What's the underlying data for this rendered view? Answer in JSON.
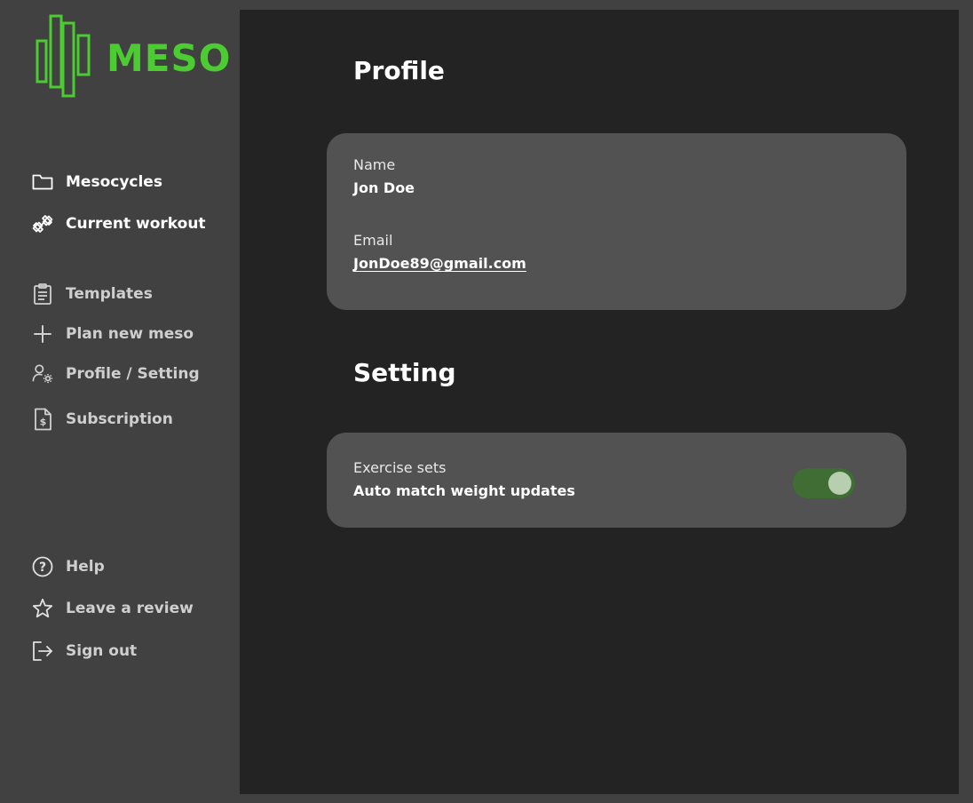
{
  "brand": {
    "name": "MESO",
    "color": "#4ccb32"
  },
  "sidebar": {
    "primary": [
      {
        "label": "Mesocycles",
        "icon": "folder-icon"
      },
      {
        "label": "Current workout",
        "icon": "dumbbell-icon"
      }
    ],
    "secondary": [
      {
        "label": "Templates",
        "icon": "clipboard-icon"
      },
      {
        "label": "Plan new meso",
        "icon": "plus-icon"
      },
      {
        "label": "Profile / Setting",
        "icon": "user-gear-icon"
      },
      {
        "label": "Subscription",
        "icon": "dollar-document-icon"
      }
    ],
    "bottom": [
      {
        "label": "Help",
        "icon": "help-icon"
      },
      {
        "label": "Leave a review",
        "icon": "star-icon"
      },
      {
        "label": "Sign out",
        "icon": "sign-out-icon"
      }
    ]
  },
  "profile": {
    "title": "Profile",
    "name_label": "Name",
    "name_value": "Jon Doe",
    "email_label": "Email",
    "email_value": "JonDoe89@gmail.com"
  },
  "setting": {
    "title": "Setting",
    "item_label": "Exercise sets",
    "item_value": "Auto match weight updates",
    "toggle_on": true,
    "toggle_color": "#3f6d34"
  }
}
